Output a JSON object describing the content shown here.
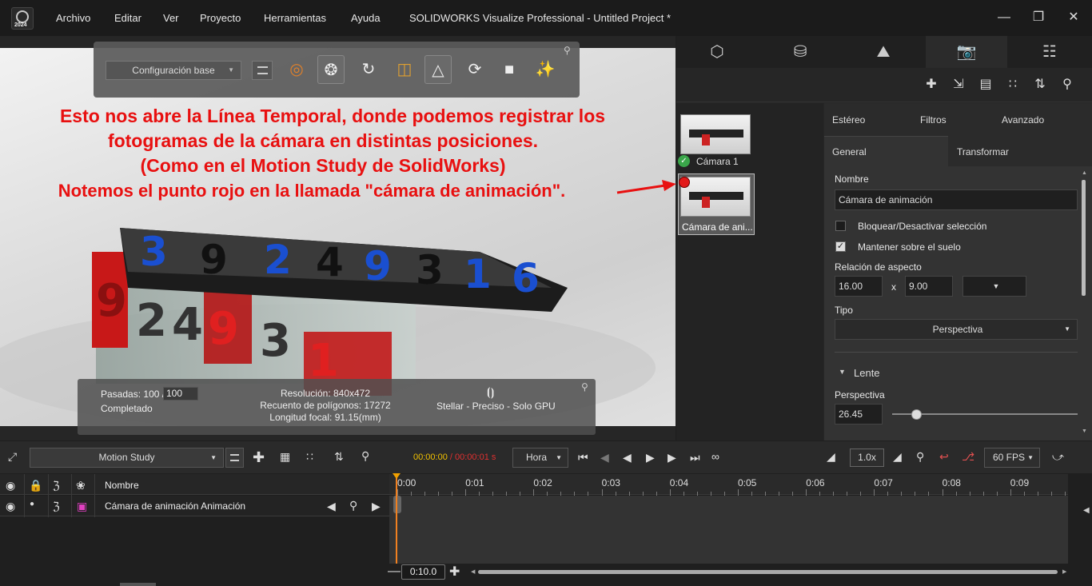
{
  "titlebar": {
    "logo_year": "2024",
    "menu": [
      "Archivo",
      "Editar",
      "Ver",
      "Proyecto",
      "Herramientas",
      "Ayuda"
    ],
    "title": "SOLIDWORKS Visualize Professional - Untitled Project *",
    "buttons": {
      "minimize": "minimize-icon",
      "restore": "restore-icon",
      "close": "close-icon"
    }
  },
  "viewport": {
    "config_dropdown": "Configuración base",
    "annotation": [
      "Esto nos abre la Línea Temporal, donde podemos registrar los",
      "fotogramas de la cámara en distintas posiciones.",
      "(Como en el Motion Study de SolidWorks)",
      "Notemos el punto rojo en la llamada \"cámara de animación\"."
    ],
    "status": {
      "passes_label": "Pasadas:",
      "passes_value": "100 /",
      "passes_target": "100",
      "completed": "Completado",
      "resolution": "Resolución: 840x472",
      "polygons": "Recuento de polígonos: 17272",
      "focal": "Longitud focal: 91.15(mm)",
      "renderer": "Stellar - Preciso - Solo GPU"
    },
    "block_digits": [
      "3",
      "9",
      "2",
      "4",
      "9",
      "3",
      "1",
      "6"
    ],
    "cube_digits": [
      "9",
      "2",
      "4",
      "9",
      "3",
      "1"
    ],
    "colors": {
      "annotation": "#e81010",
      "accent": "#f0a000"
    }
  },
  "right_panel": {
    "tabs": [
      "cube-icon",
      "database-icon",
      "image-icon",
      "camera-icon",
      "library-icon"
    ],
    "cameras": [
      {
        "label": "Cámara 1",
        "active": true
      },
      {
        "label": "Cámara de ani...",
        "animated": true
      }
    ],
    "subtabs_row1": [
      "Estéreo",
      "Filtros",
      "Avanzado"
    ],
    "subtabs_row2": [
      "General",
      "Transformar"
    ],
    "name_label": "Nombre",
    "name_value": "Cámara de animación",
    "lock_label": "Bloquear/Desactivar selección",
    "lock_checked": false,
    "ground_label": "Mantener sobre el suelo",
    "ground_checked": true,
    "aspect_label": "Relación de aspecto",
    "aspect_w": "16.00",
    "aspect_x": "x",
    "aspect_h": "9.00",
    "type_label": "Tipo",
    "type_value": "Perspectiva",
    "lens_label": "Lente",
    "persp_label": "Perspectiva",
    "persp_value": "26.45",
    "persp_slider": 0.13
  },
  "timeline": {
    "study_dropdown": "Motion Study",
    "time_current": "00:00:00",
    "time_sep": " / ",
    "time_end": "00:00:01",
    "time_unit": "s",
    "time_mode": "Hora",
    "speed": "1.0x",
    "fps": "60 FPS",
    "columns_header": "Nombre",
    "row_label": "Cámara de animación Animación",
    "ruler": [
      "0:00",
      "0:01",
      "0:02",
      "0:03",
      "0:04",
      "0:05",
      "0:06",
      "0:07",
      "0:08",
      "0:09"
    ],
    "zoom_value": "0:10.0"
  }
}
